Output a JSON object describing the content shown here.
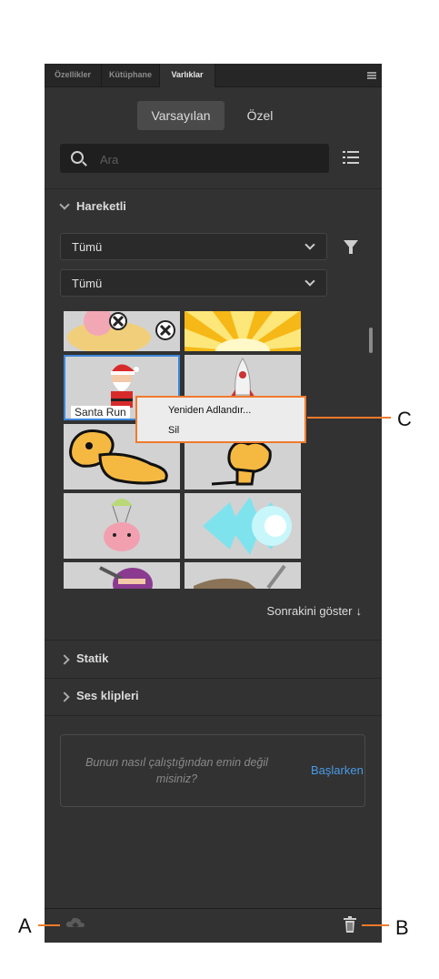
{
  "tabs": [
    {
      "label": "Özellikler",
      "active": false
    },
    {
      "label": "Kütüphane",
      "active": false
    },
    {
      "label": "Varlıklar",
      "active": true
    }
  ],
  "toggle": {
    "default_label": "Varsayılan",
    "custom_label": "Özel"
  },
  "search": {
    "placeholder": "Ara"
  },
  "animated_section": {
    "title": "Hareketli",
    "filter1": "Tümü",
    "filter2": "Tümü"
  },
  "thumbnails": [
    {
      "label": ""
    },
    {
      "label": ""
    },
    {
      "label": "Santa Run"
    },
    {
      "label": ""
    },
    {
      "label": ""
    },
    {
      "label": ""
    },
    {
      "label": ""
    },
    {
      "label": ""
    },
    {
      "label": ""
    },
    {
      "label": ""
    }
  ],
  "context_menu": {
    "rename": "Yeniden Adlandır...",
    "delete": "Sil"
  },
  "show_more": {
    "label": "Sonrakini göster"
  },
  "sections": [
    {
      "title": "Statik"
    },
    {
      "title": "Ses klipleri"
    }
  ],
  "help": {
    "text": "Bunun nasıl çalıştığından emin değil misiniz?",
    "link": "Başlarken"
  },
  "callouts": {
    "a": "A",
    "b": "B",
    "c": "C"
  },
  "colors": {
    "accent": "#f07a2a",
    "link": "#4a9ae6",
    "selection": "#3d86d8"
  }
}
